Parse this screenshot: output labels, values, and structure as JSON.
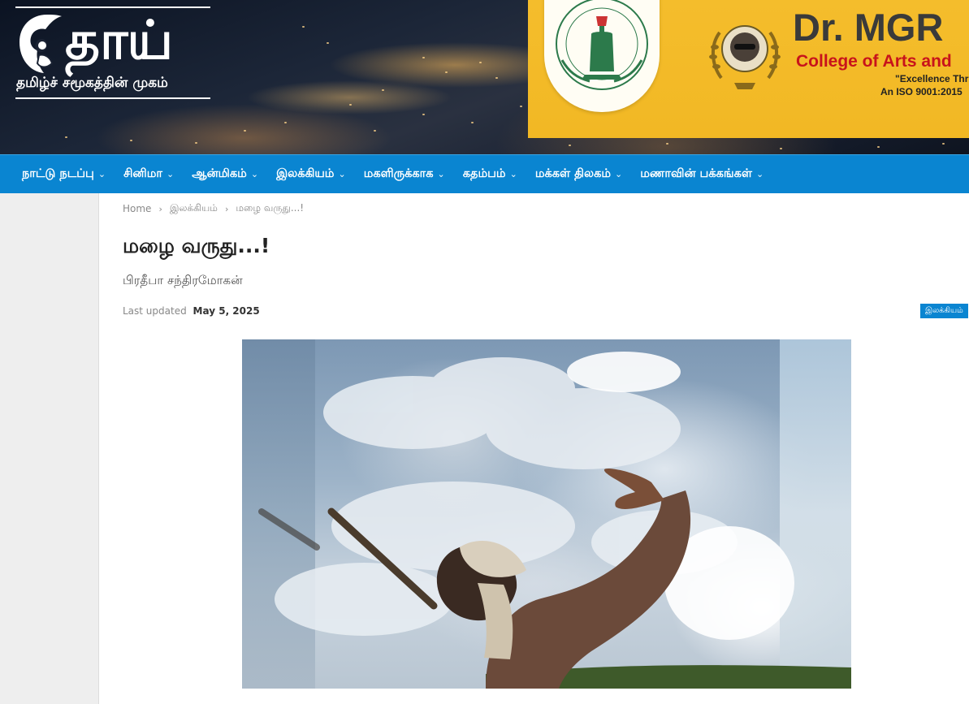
{
  "site": {
    "logo_word": "தாய்",
    "tagline": "தமிழ்ச் சமூகத்தின் முகம்"
  },
  "banner": {
    "name": "Dr. MGR",
    "college": "College of Arts and",
    "motto": "\"Excellence Thr",
    "iso": "An ISO 9001:2015",
    "seal_text": "DR. MGR JA... FOR WOMEN · EXCELLENCE THROUGH DILIGENCE"
  },
  "nav": {
    "items": [
      {
        "label": "நாட்டு நடப்பு"
      },
      {
        "label": "சினிமா"
      },
      {
        "label": "ஆன்மிகம்"
      },
      {
        "label": "இலக்கியம்"
      },
      {
        "label": "மகளிருக்காக"
      },
      {
        "label": "கதம்பம்"
      },
      {
        "label": "மக்கள் திலகம்"
      },
      {
        "label": "மணாவின் பக்கங்கள்"
      }
    ]
  },
  "breadcrumb": {
    "home": "Home",
    "category": "இலக்கியம்",
    "current": "மழை வருது...!"
  },
  "article": {
    "title": "மழை வருது...!",
    "author": "பிரதீபா சந்திரமோகன்",
    "updated_label": "Last updated",
    "updated_date": "May 5, 2025",
    "category_badge": "இலக்கியம்"
  },
  "colors": {
    "nav_bg": "#0a85d1",
    "banner_bg": "#f4bd2c",
    "banner_name": "#3a3a3a",
    "banner_college": "#c8131b"
  }
}
